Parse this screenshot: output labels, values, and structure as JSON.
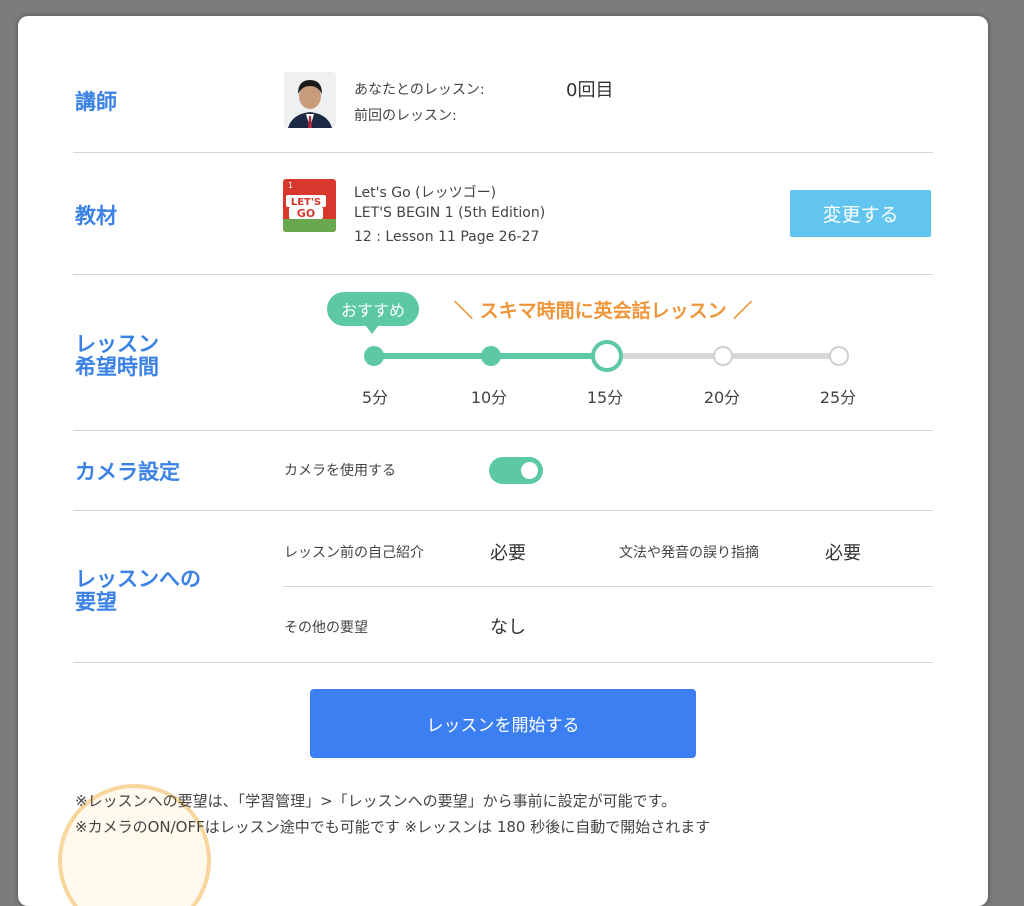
{
  "teacher": {
    "title": "講師",
    "lessons_with_you_label": "あなたとのレッスン:",
    "lessons_with_you_value": "0回目",
    "previous_lesson_label": "前回のレッスン:"
  },
  "material": {
    "title": "教材",
    "line1": "Let's Go (レッツゴー)",
    "line2": "LET'S BEGIN 1 (5th Edition)",
    "line3": "12 : Lesson 11 Page 26-27",
    "change_button": "変更する"
  },
  "duration": {
    "title_line1": "レッスン",
    "title_line2": "希望時間",
    "badge": "おすすめ",
    "promo": "＼ スキマ時間に英会話レッスン ／",
    "options": [
      "5分",
      "10分",
      "15分",
      "20分",
      "25分"
    ],
    "selected": "15分"
  },
  "camera": {
    "title": "カメラ設定",
    "label": "カメラを使用する",
    "enabled": true
  },
  "requests": {
    "title_line1": "レッスンへの",
    "title_line2": "要望",
    "self_intro_label": "レッスン前の自己紹介",
    "self_intro_value": "必要",
    "correction_label": "文法や発音の誤り指摘",
    "correction_value": "必要",
    "other_label": "その他の要望",
    "other_value": "なし"
  },
  "start_button": "レッスンを開始する",
  "notes": {
    "line1": "※レッスンへの要望は、「学習管理」>「レッスンへの要望」から事前に設定が可能です。",
    "line2": "※カメラのON/OFFはレッスン途中でも可能です ※レッスンは 180 秒後に自動で開始されます"
  },
  "colors": {
    "accent_blue": "#3b82e6",
    "button_blue": "#3b7ff2",
    "change_button": "#62c5f0",
    "green": "#5cc8a4",
    "orange": "#f0963a"
  }
}
